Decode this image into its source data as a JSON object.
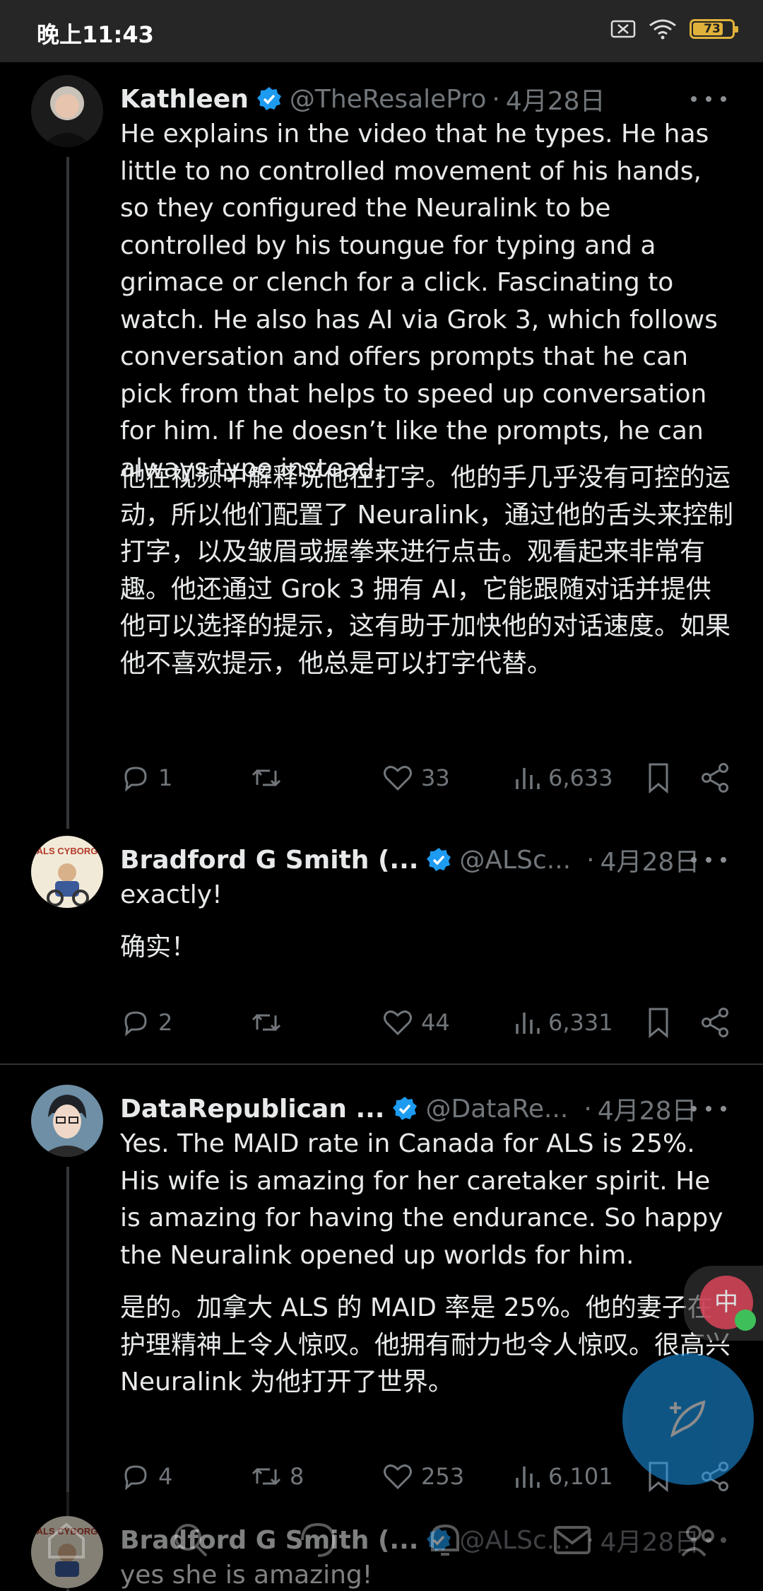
{
  "status_bar": {
    "time": "晚上11:43",
    "battery": "73"
  },
  "tweets": [
    {
      "name": "Kathleen",
      "handle": "@TheResalePro",
      "sep": "·",
      "date": "4月28日",
      "text_en": "He explains in the video that he types. He has little to no controlled movement of his hands, so they configured the Neuralink to be controlled by his toungue for typing and a grimace or clench for a click. Fascinating to watch. He also has AI via Grok 3, which follows conversation and offers prompts that he can pick from that helps to speed up conversation for him. If he doesn’t like the prompts, he can always type instead.",
      "text_cn": "他在视频中解释说他在打字。他的手几乎没有可控的运动，所以他们配置了 Neuralink，通过他的舌头来控制打字，以及皱眉或握拳来进行点击。观看起来非常有趣。他还通过 Grok 3 拥有 AI，它能跟随对话并提供他可以选择的提示，这有助于加快他的对话速度。如果他不喜欢提示，他总是可以打字代替。",
      "replies": "1",
      "reposts": "",
      "likes": "33",
      "views": "6,633"
    },
    {
      "name": "Bradford G Smith (...",
      "handle": "@ALSc...",
      "sep": "·",
      "date": "4月28日",
      "text_en": "exactly!",
      "text_cn": "确实！",
      "replies": "2",
      "reposts": "",
      "likes": "44",
      "views": "6,331"
    },
    {
      "name": "DataRepublican ...",
      "handle": "@DataRe...",
      "sep": "·",
      "date": "4月28日",
      "text_en": "Yes. The MAID rate in Canada for ALS is 25%. His wife is amazing for her caretaker spirit. He is amazing for having the endurance. So happy the Neuralink opened up worlds for him.",
      "text_cn": "是的。加拿大 ALS 的 MAID 率是 25%。他的妻子在护理精神上令人惊叹。他拥有耐力也令人惊叹。很高兴 Neuralink 为他打开了世界。",
      "replies": "4",
      "reposts": "8",
      "likes": "253",
      "views": "6,101"
    },
    {
      "name": "Bradford G Smith (...",
      "handle": "@ALSc...",
      "sep": "·",
      "date": "4月28日",
      "text_en": "yes she is amazing!"
    }
  ],
  "avatar_labels": {
    "als_cyborg": "ALS CYBORG"
  },
  "float_badge": {
    "label": "中"
  },
  "colors": {
    "background": "#000000",
    "text": "#e7e9ea",
    "muted": "#71767b",
    "verified": "#1d9bf0",
    "accent": "#1d9bf0"
  },
  "icons": [
    "reply-icon",
    "repost-icon",
    "like-icon",
    "views-icon",
    "bookmark-icon",
    "share-icon",
    "verified-badge-icon",
    "compose-icon",
    "home-icon",
    "search-icon",
    "spaces-icon",
    "notifications-icon",
    "messages-icon",
    "communities-icon"
  ]
}
